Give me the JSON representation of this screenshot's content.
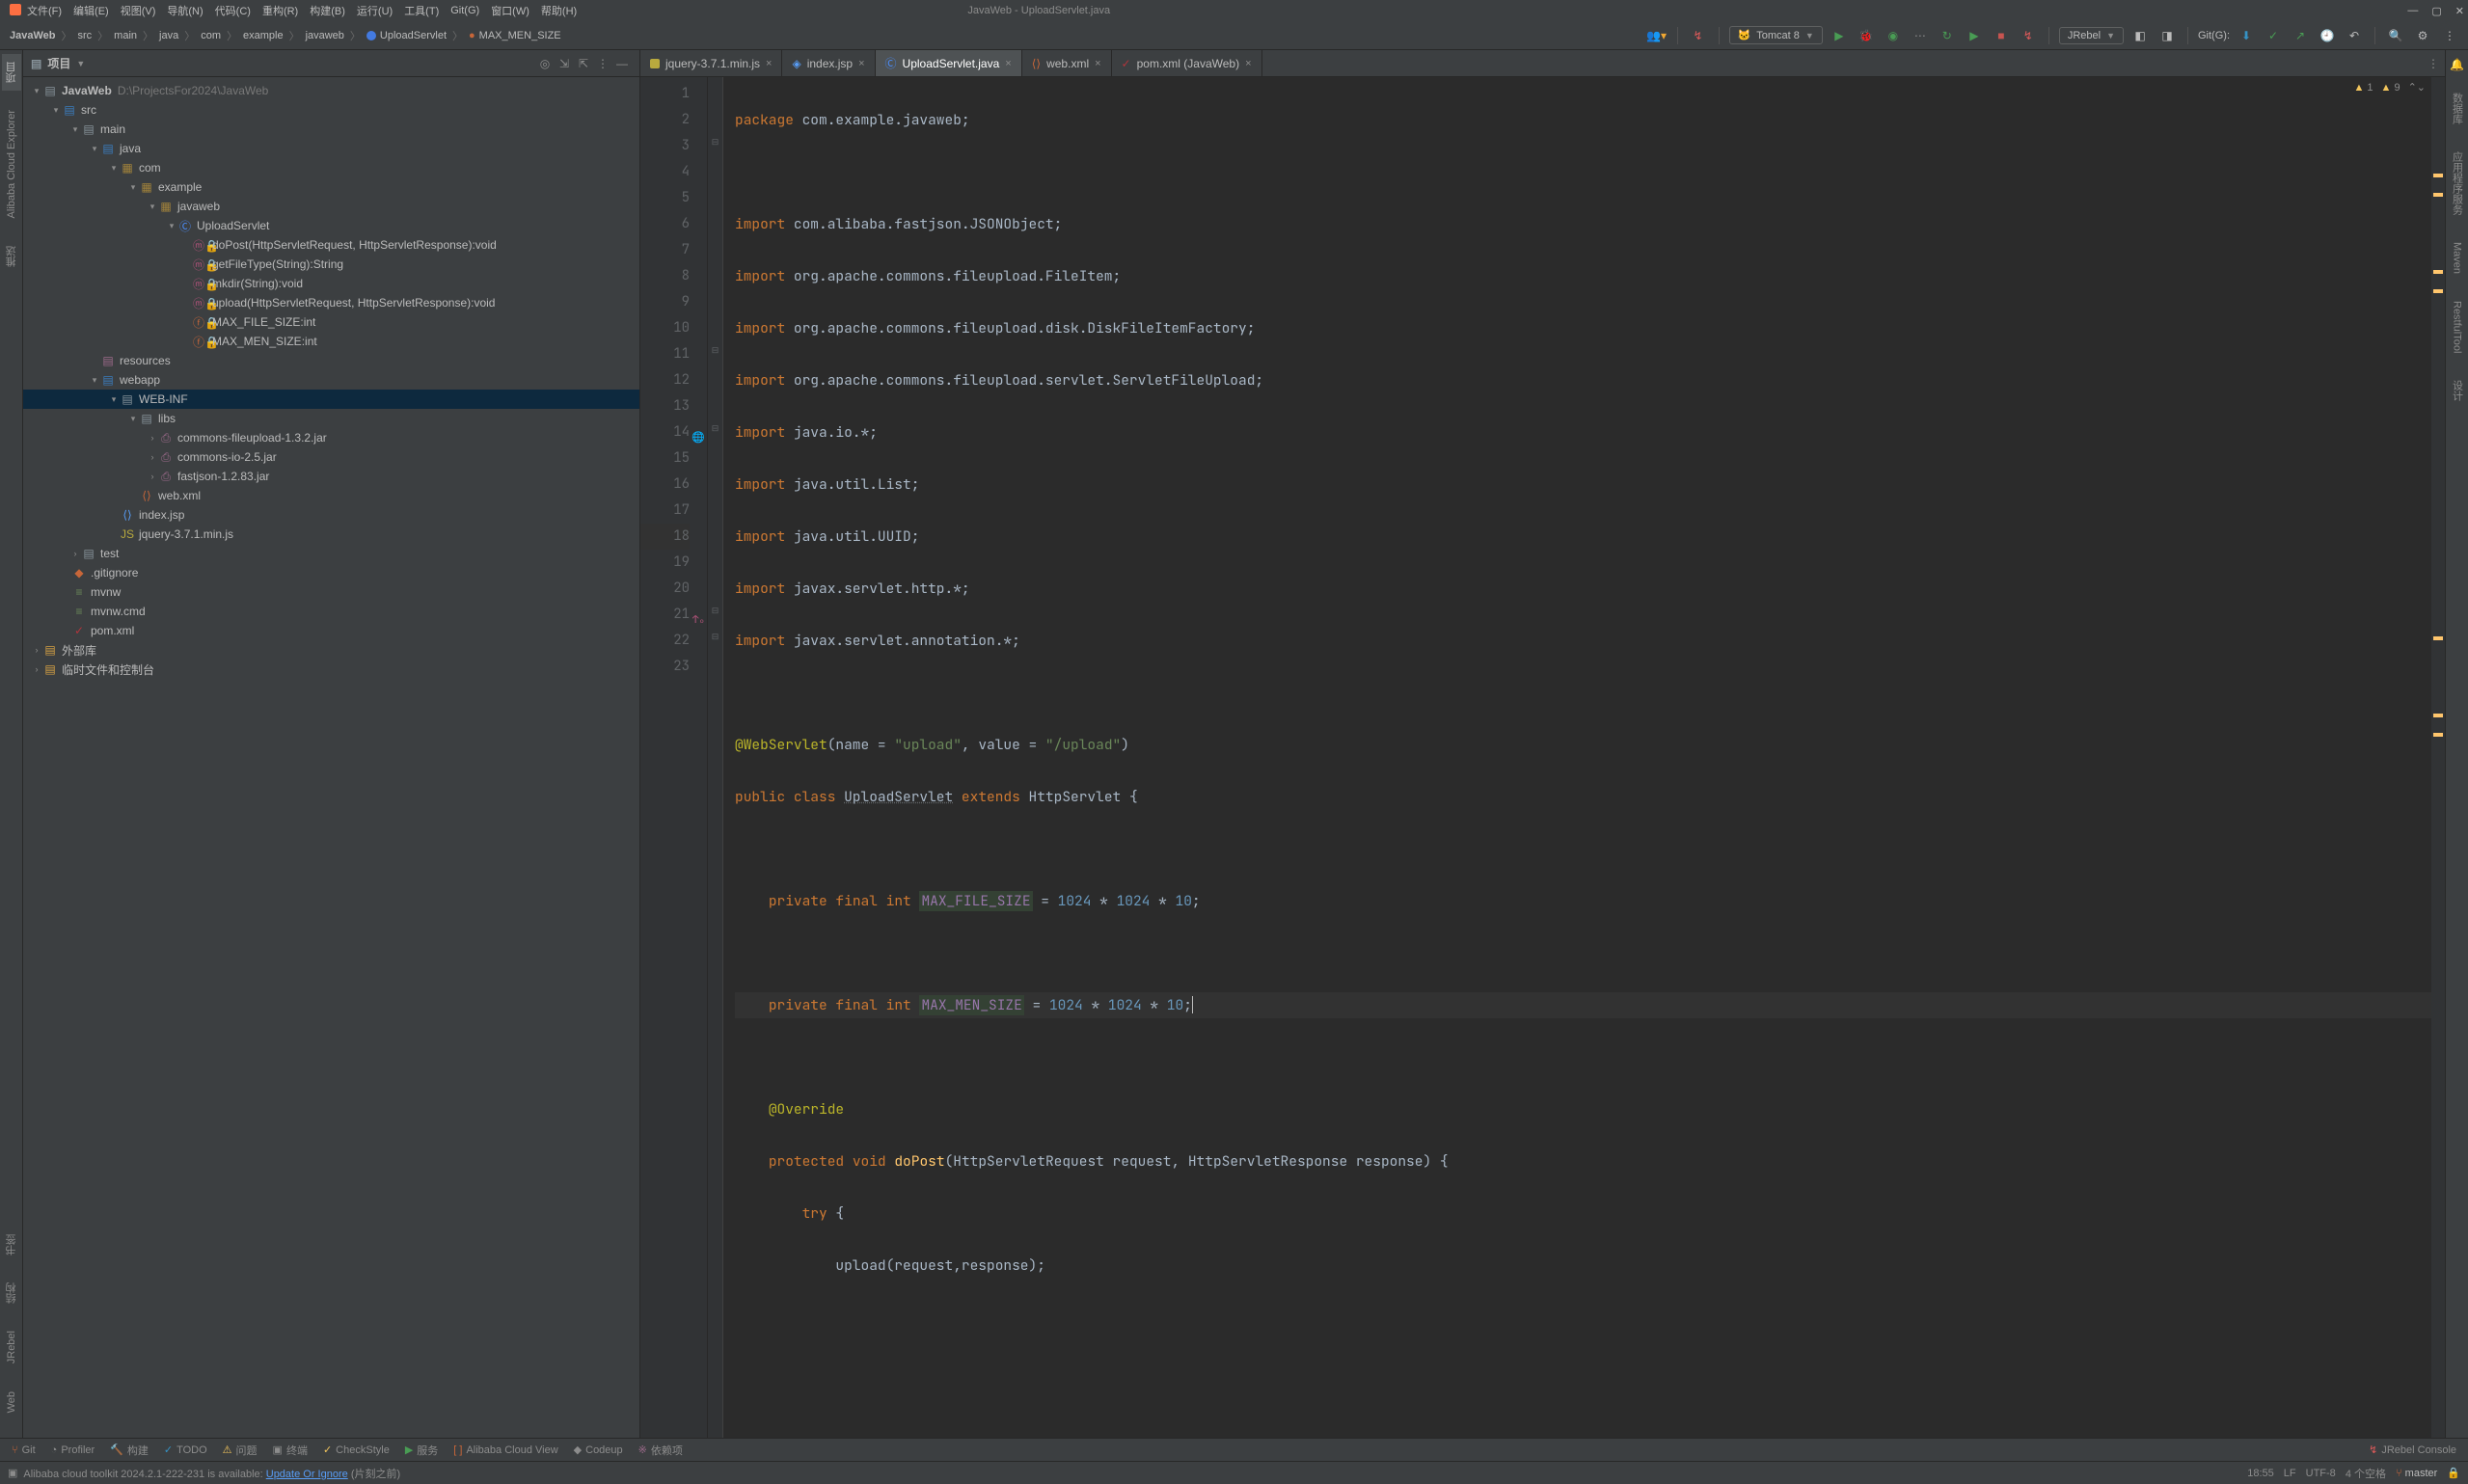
{
  "title": {
    "app": "JavaWeb - UploadServlet.java"
  },
  "menu": [
    "文件(F)",
    "编辑(E)",
    "视图(V)",
    "导航(N)",
    "代码(C)",
    "重构(R)",
    "构建(B)",
    "运行(U)",
    "工具(T)",
    "Git(G)",
    "窗口(W)",
    "帮助(H)"
  ],
  "crumb": [
    "JavaWeb",
    "src",
    "main",
    "java",
    "com",
    "example",
    "javaweb",
    "UploadServlet",
    "MAX_MEN_SIZE"
  ],
  "runcfg": {
    "tomcat": "Tomcat 8",
    "jrebel": "JRebel",
    "git": "Git(G):"
  },
  "project": {
    "title": "项目",
    "root": "JavaWeb",
    "rootPath": "D:\\ProjectsFor2024\\JavaWeb",
    "nodes": {
      "src": "src",
      "main": "main",
      "java": "java",
      "com": "com",
      "example": "example",
      "javaweb": "javaweb",
      "uploadServlet": "UploadServlet",
      "doPost": "doPost(HttpServletRequest, HttpServletResponse):void",
      "getFileType": "getFileType(String):String",
      "mkdir": "mkdir(String):void",
      "upload": "upload(HttpServletRequest, HttpServletResponse):void",
      "maxFile": "MAX_FILE_SIZE:int",
      "maxMen": "MAX_MEN_SIZE:int",
      "resources": "resources",
      "webapp": "webapp",
      "webinf": "WEB-INF",
      "libs": "libs",
      "lib1": "commons-fileupload-1.3.2.jar",
      "lib2": "commons-io-2.5.jar",
      "lib3": "fastjson-1.2.83.jar",
      "webxml": "web.xml",
      "indexjsp": "index.jsp",
      "jquery": "jquery-3.7.1.min.js",
      "test": "test",
      "gitignore": ".gitignore",
      "mvnw": "mvnw",
      "mvnwcmd": "mvnw.cmd",
      "pomxml": "pom.xml",
      "external": "外部库",
      "scratch": "临时文件和控制台"
    }
  },
  "tabs": [
    {
      "name": "jquery-3.7.1.min.js",
      "icon": "js"
    },
    {
      "name": "index.jsp",
      "icon": "jsp"
    },
    {
      "name": "UploadServlet.java",
      "icon": "java",
      "active": true
    },
    {
      "name": "web.xml",
      "icon": "xml"
    },
    {
      "name": "pom.xml (JavaWeb)",
      "icon": "pom"
    }
  ],
  "inspections": {
    "weak": "1",
    "warn": "9"
  },
  "code": {
    "lines": [
      1,
      2,
      3,
      4,
      5,
      6,
      7,
      8,
      9,
      10,
      11,
      12,
      13,
      14,
      15,
      16,
      17,
      18,
      19,
      20,
      21,
      22,
      23
    ],
    "l1_pkg": "package",
    "l1_pkgname": "com.example.javaweb",
    "l3": "com.alibaba.fastjson.JSONObject",
    "l4": "org.apache.commons.fileupload.FileItem",
    "l5": "org.apache.commons.fileupload.disk.DiskFileItemFactory",
    "l6": "org.apache.commons.fileupload.servlet.ServletFileUpload",
    "l7": "java.io.*",
    "l8": "java.util.List",
    "l9": "java.util.UUID",
    "l10": "javax.servlet.http.*",
    "l11": "javax.servlet.annotation.*",
    "import": "import",
    "l13_ann": "@WebServlet",
    "l13_name": "name = ",
    "l13_nameval": "\"upload\"",
    "l13_val": ", value = ",
    "l13_valval": "\"/upload\"",
    "l14_pub": "public",
    "l14_cls": "class",
    "l14_name": "UploadServlet",
    "l14_ext": "extends",
    "l14_sup": "HttpServlet",
    "l16_priv": "private",
    "l16_fin": "final",
    "l16_int": "int",
    "l16_fld": "MAX_FILE_SIZE",
    "l16_eq": " = ",
    "l16_n1": "1024",
    "l16_star": " * ",
    "l16_n2": "1024",
    "l16_n3": "10",
    "l18_fld": "MAX_MEN_SIZE",
    "l20_ann": "@Override",
    "l21_prot": "protected",
    "l21_void": "void",
    "l21_fn": "doPost",
    "l21_p1": "HttpServletRequest request",
    "l21_p2": "HttpServletResponse response",
    "l22_try": "try",
    "l23_fn": "upload",
    "l23_args": "(request,response);"
  },
  "footer": {
    "tools": [
      "Git",
      "Profiler",
      "构建",
      "TODO",
      "问题",
      "终端",
      "CheckStyle",
      "服务",
      "Alibaba Cloud View",
      "Codeup",
      "依赖项"
    ],
    "right": "JRebel Console"
  },
  "status": {
    "msg": "Alibaba cloud toolkit 2024.2.1-222-231 is available: ",
    "link": "Update Or Ignore",
    "suffix": "(片刻之前)",
    "pos": "18:55",
    "le": "LF",
    "enc": "UTF-8",
    "ind": "4 个空格",
    "branch": "master"
  },
  "rails": {
    "left": [
      "项目",
      "Alibaba Cloud Explorer",
      "推送",
      "书签",
      "结构",
      "JRebel",
      "Web"
    ],
    "right": [
      "通知",
      "数据库",
      "应用程序服务",
      "Maven",
      "RestfulTool",
      "设计"
    ]
  }
}
